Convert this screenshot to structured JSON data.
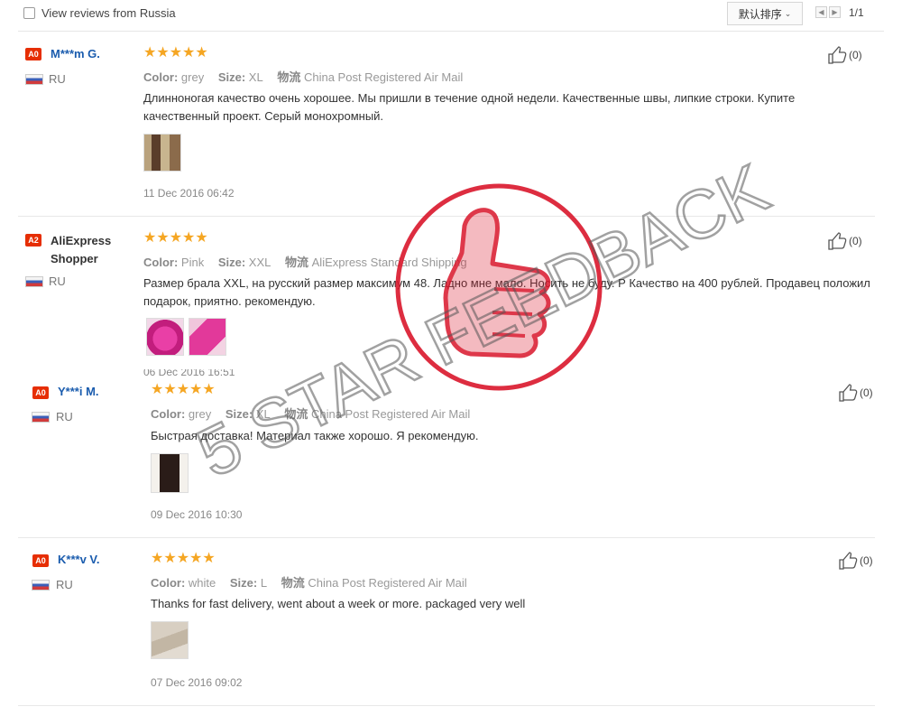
{
  "filter": {
    "russia_label": "View reviews from Russia",
    "checked": false
  },
  "sort": {
    "label": "默认排序"
  },
  "pager": {
    "count": "1/1"
  },
  "reviews": [
    {
      "badge": "A0",
      "name": "M***m G.",
      "country": "RU",
      "stars": "★★★★★",
      "color_key": "Color:",
      "color_val": "grey",
      "size_key": "Size:",
      "size_val": "XL",
      "ship_key": "物流",
      "ship_val": "China Post Registered Air Mail",
      "text": "Длинноногая качество очень хорошее. Мы пришли в течение одной недели. Качественные швы, липкие строки. Купите качественный проект. Серый монохромный.",
      "date": "11 Dec 2016 06:42",
      "likes": "(0)"
    },
    {
      "badge": "A2",
      "name": "AliExpress Shopper",
      "country": "RU",
      "stars": "★★★★★",
      "color_key": "Color:",
      "color_val": "Pink",
      "size_key": "Size:",
      "size_val": "XXL",
      "ship_key": "物流",
      "ship_val": "AliExpress Standard Shipping",
      "text": "Размер брала XXL, на русский размер максимум 48. Ладно мне мало. Носить не буду. Р Качество на 400 рублей. Продавец положил подарок, приятно. рекомендую.",
      "date": "06 Dec 2016 16:51",
      "likes": "(0)"
    },
    {
      "badge": "A0",
      "name": "Y***i M.",
      "country": "RU",
      "stars": "★★★★★",
      "color_key": "Color:",
      "color_val": "grey",
      "size_key": "Size:",
      "size_val": "XL",
      "ship_key": "物流",
      "ship_val": "China Post Registered Air Mail",
      "text": "Быстрая доставка! Материал также хорошо. Я рекомендую.",
      "date": "09 Dec 2016 10:30",
      "likes": "(0)"
    },
    {
      "badge": "A0",
      "name": "K***v V.",
      "country": "RU",
      "stars": "★★★★★",
      "color_key": "Color:",
      "color_val": "white",
      "size_key": "Size:",
      "size_val": "L",
      "ship_key": "物流",
      "ship_val": "China Post Registered Air Mail",
      "text": "Thanks for fast delivery, went about a week or more. packaged very well",
      "date": "07 Dec 2016 09:02",
      "likes": "(0)"
    }
  ],
  "watermark": {
    "text": "5 STAR FEEDBACK",
    "color": "#d9162b"
  },
  "colors": {
    "star": "#f5a623",
    "badge": "#e62e04",
    "link": "#1a5cae"
  }
}
